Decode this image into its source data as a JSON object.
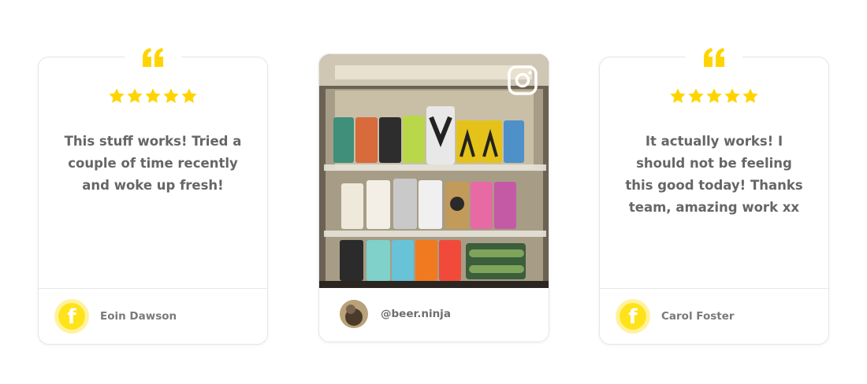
{
  "colors": {
    "accent": "#ffd400",
    "text": "#666666",
    "border": "#e6e6e6"
  },
  "reviews": [
    {
      "rating": 5,
      "text": "This stuff works! Tried a couple of time recently and woke up fresh!",
      "source_icon": "facebook-icon",
      "author": "Eoin Dawson"
    },
    {
      "rating": 5,
      "text": "It actually works! I should not be feeling this good today! Thanks team, amazing work xx",
      "source_icon": "facebook-icon",
      "author": "Carol Foster"
    }
  ],
  "instagram_post": {
    "source_icon": "instagram-icon",
    "image": "fridge-full-of-beer-cans-photo",
    "handle": "@beer.ninja"
  }
}
